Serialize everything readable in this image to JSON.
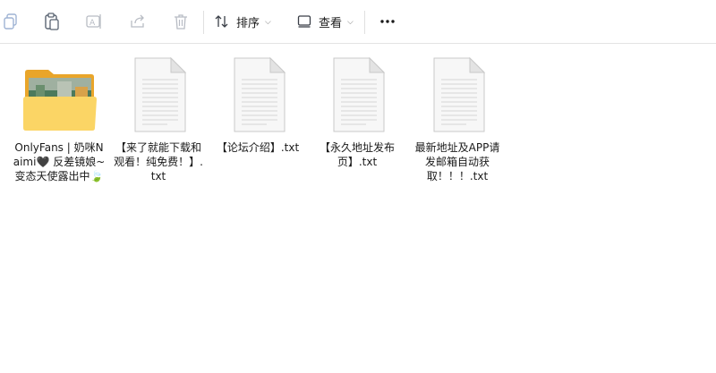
{
  "toolbar": {
    "copy_icon": "copy-icon",
    "paste_icon": "paste-icon",
    "rename_icon": "rename-icon",
    "share_icon": "share-icon",
    "delete_icon": "trash-icon",
    "sort_label": "排序",
    "view_label": "查看",
    "more_icon": "more-icon"
  },
  "files": [
    {
      "name": "OnlyFans | 奶咪Naimi🖤 反差镜娘~变态天使露出中🍃",
      "type": "folder"
    },
    {
      "name": "【来了就能下载和观看！纯免费！】.txt",
      "type": "text-file"
    },
    {
      "name": "【论坛介绍】.txt",
      "type": "text-file"
    },
    {
      "name": "【永久地址发布页】.txt",
      "type": "text-file"
    },
    {
      "name": "最新地址及APP请发邮箱自动获取！！！.txt",
      "type": "text-file"
    }
  ],
  "colors": {
    "folder_back": "#e9a52a",
    "folder_front": "#fbd565",
    "toolbar_border": "#e3e3e3",
    "disabled_icon": "#b8bcc4"
  }
}
